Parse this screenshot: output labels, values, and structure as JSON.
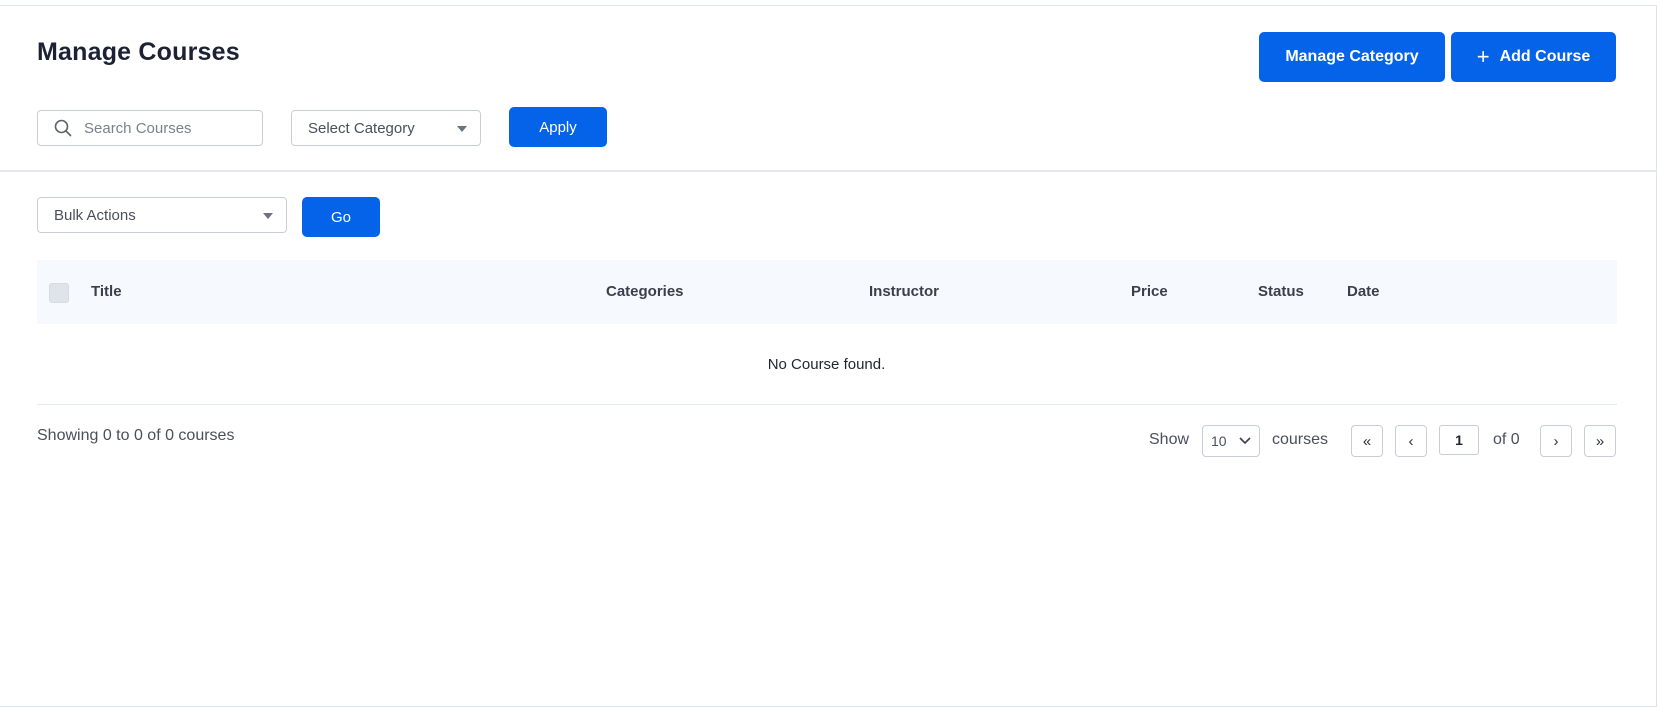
{
  "header": {
    "title": "Manage Courses",
    "manage_category_label": "Manage Category",
    "add_course_label": "Add Course"
  },
  "filters": {
    "search_placeholder": "Search Courses",
    "category_select": "Select Category",
    "apply_label": "Apply"
  },
  "bulk": {
    "select_label": "Bulk Actions",
    "go_label": "Go"
  },
  "table": {
    "columns": [
      "Title",
      "Categories",
      "Instructor",
      "Price",
      "Status",
      "Date"
    ],
    "empty_message": "No Course found."
  },
  "footer": {
    "showing_text": "Showing 0 to 0 of 0 courses",
    "show_label": "Show",
    "per_page": "10",
    "courses_label": "courses",
    "first_glyph": "«",
    "prev_glyph": "‹",
    "current_page": "1",
    "of_text": "of 0",
    "next_glyph": "›",
    "last_glyph": "»"
  },
  "colors": {
    "primary": "#0563ea",
    "header_row_bg": "#f6f9fd",
    "border": "#c9ced6"
  },
  "icons": {
    "search": "search-icon",
    "plus": "plus-icon",
    "caret": "caret-down-icon",
    "chevron": "chevron-down-icon"
  }
}
